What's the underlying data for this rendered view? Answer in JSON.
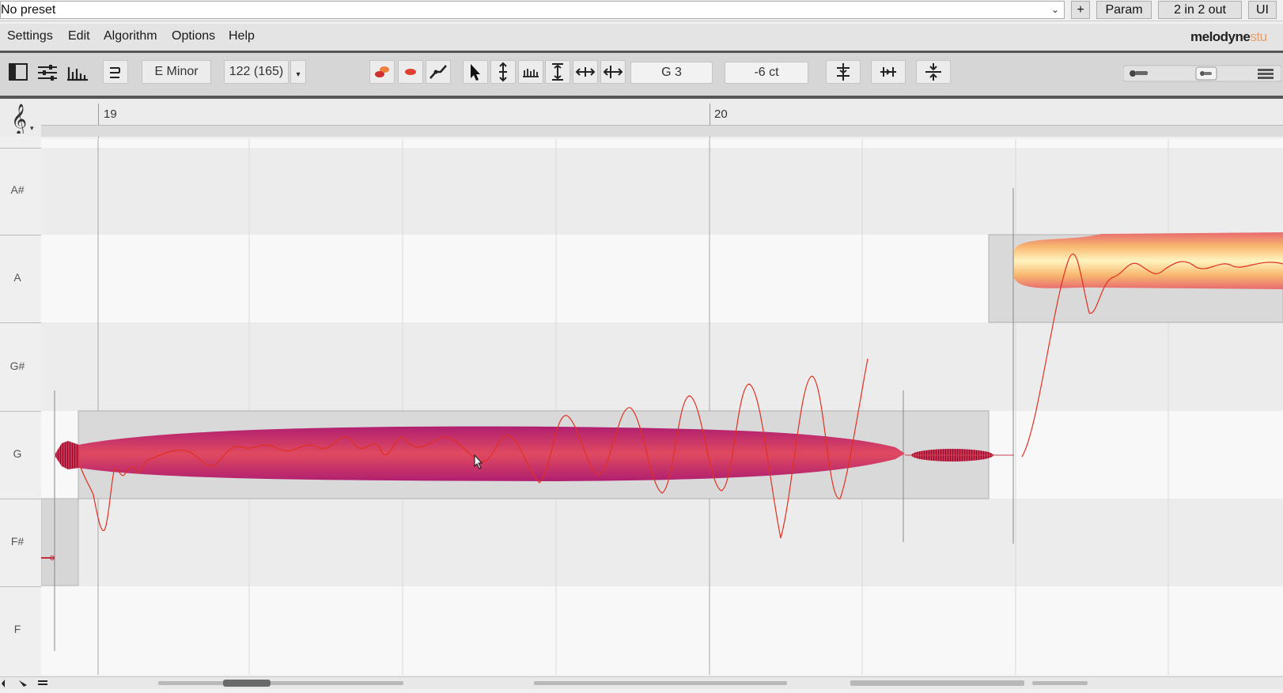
{
  "host": {
    "preset": "No preset",
    "buttons": {
      "plus": "+",
      "param": "Param",
      "io": "2 in 2 out",
      "ui": "UI"
    }
  },
  "menu": [
    "Settings",
    "Edit",
    "Algorithm",
    "Options",
    "Help"
  ],
  "logo": {
    "brand": "melodyne",
    "suffix": "stu"
  },
  "toolbar": {
    "scale": "E Minor",
    "tempo": "122 (165)",
    "pitch": "G 3",
    "cents": "-6 ct"
  },
  "ruler": {
    "bars": [
      "19",
      "20"
    ]
  },
  "pitch_lanes": [
    "A#",
    "A",
    "G#",
    "G",
    "F#",
    "F"
  ],
  "colors": {
    "blob_main": "#c42a6f",
    "blob_bright": "#f6c070",
    "pitch_curve": "#e04020",
    "lane_light": "#f8f8f8",
    "lane_dark": "#ececec"
  },
  "icons": [
    "clef-icon",
    "layout-icon",
    "mixer-icon",
    "spectrum-icon",
    "macro-icon",
    "select-tool-icon",
    "pitch-tool-icon",
    "time-tool-icon"
  ]
}
